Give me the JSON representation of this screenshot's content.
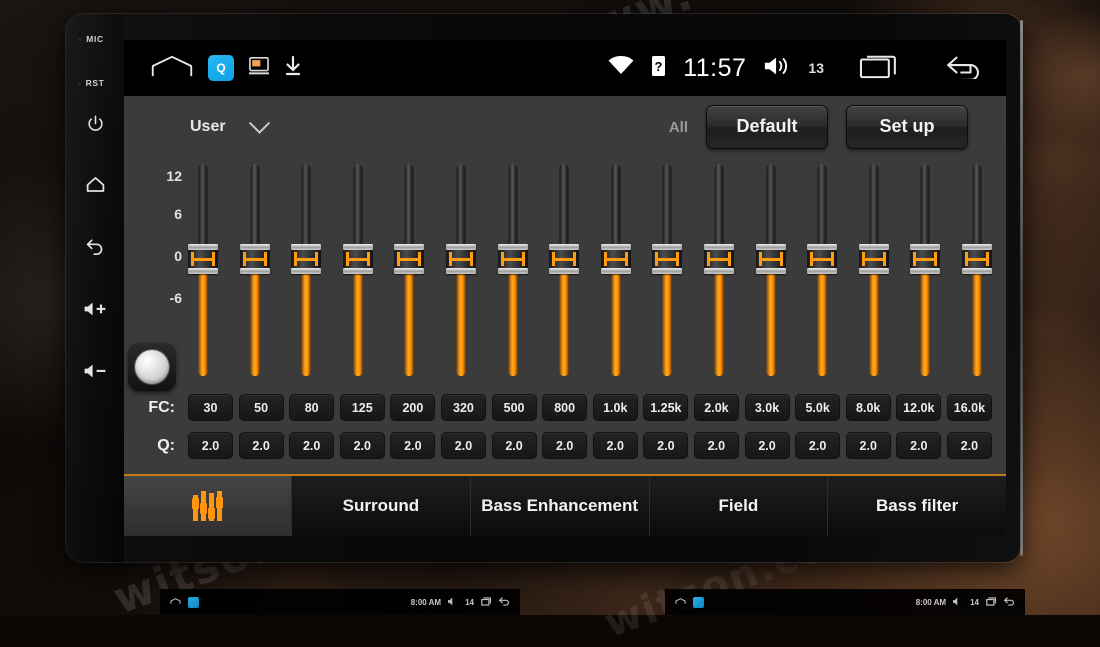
{
  "device": {
    "bezel_labels": [
      "MIC",
      "RST"
    ],
    "bezel_buttons": [
      {
        "name": "power-icon",
        "glyph": "⏻"
      },
      {
        "name": "home-icon",
        "glyph": "⌂"
      },
      {
        "name": "back-icon",
        "glyph": "↩"
      },
      {
        "name": "volume-up-icon",
        "glyph": "🔊+"
      },
      {
        "name": "volume-down-icon",
        "glyph": "🔊-"
      }
    ]
  },
  "statusbar": {
    "home_icon": "home-outline-icon",
    "app_icon_label": "Q",
    "screencast_icon": "screencast-icon",
    "download_icon": "download-icon",
    "wifi_icon": "wifi-icon",
    "sim_icon": "sim-card-icon",
    "time": "11:57",
    "volume_icon": "volume-icon",
    "volume_level": "13",
    "recents_icon": "recents-icon",
    "back_icon": "back-arrow-icon"
  },
  "eq": {
    "preset": {
      "label": "User",
      "chevron": "chevron-down-icon"
    },
    "all_label": "All",
    "default_button": "Default",
    "setup_button": "Set up",
    "axis_labels": [
      "12",
      "6",
      "0",
      "-6"
    ],
    "knob": "balance-knob",
    "fc_row_label": "FC:",
    "q_row_label": "Q:",
    "bands": [
      {
        "fc": "30",
        "q": "2.0",
        "gain": 0
      },
      {
        "fc": "50",
        "q": "2.0",
        "gain": 0
      },
      {
        "fc": "80",
        "q": "2.0",
        "gain": 0
      },
      {
        "fc": "125",
        "q": "2.0",
        "gain": 0
      },
      {
        "fc": "200",
        "q": "2.0",
        "gain": 0
      },
      {
        "fc": "320",
        "q": "2.0",
        "gain": 0
      },
      {
        "fc": "500",
        "q": "2.0",
        "gain": 0
      },
      {
        "fc": "800",
        "q": "2.0",
        "gain": 0
      },
      {
        "fc": "1.0k",
        "q": "2.0",
        "gain": 0
      },
      {
        "fc": "1.25k",
        "q": "2.0",
        "gain": 0
      },
      {
        "fc": "2.0k",
        "q": "2.0",
        "gain": 0
      },
      {
        "fc": "3.0k",
        "q": "2.0",
        "gain": 0
      },
      {
        "fc": "5.0k",
        "q": "2.0",
        "gain": 0
      },
      {
        "fc": "8.0k",
        "q": "2.0",
        "gain": 0
      },
      {
        "fc": "12.0k",
        "q": "2.0",
        "gain": 0
      },
      {
        "fc": "16.0k",
        "q": "2.0",
        "gain": 0
      }
    ]
  },
  "tabs": [
    {
      "label": "",
      "icon": "equalizer-icon",
      "active": true
    },
    {
      "label": "Surround",
      "icon": "",
      "active": false
    },
    {
      "label": "Bass Enhancement",
      "icon": "",
      "active": false
    },
    {
      "label": "Field",
      "icon": "",
      "active": false
    },
    {
      "label": "Bass filter",
      "icon": "",
      "active": false
    }
  ],
  "filmstrip": [
    {
      "time": "8:00 AM",
      "volume_level": "14"
    },
    {
      "time": "8:00 AM",
      "volume_level": "14"
    }
  ],
  "watermarks": [
    "www.",
    "www.witson.com",
    "witson.com",
    "witson"
  ],
  "colors": {
    "accent_orange": "#ff9411",
    "panel_bg": "#3b3b3b",
    "tab_divider": "#c37a14"
  }
}
